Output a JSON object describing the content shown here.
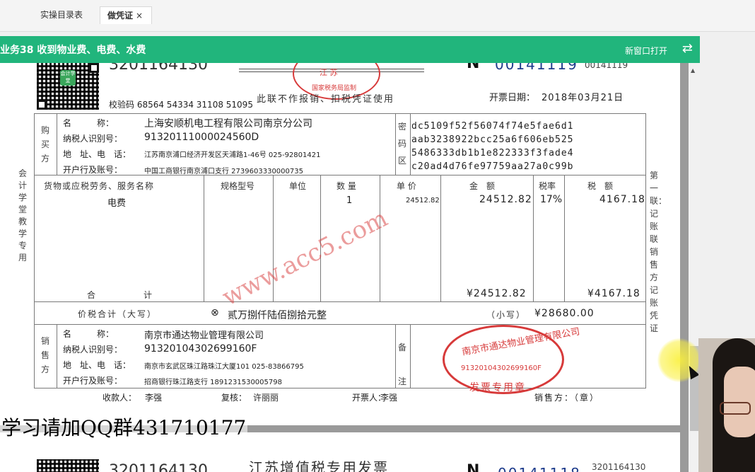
{
  "tabs": {
    "catalog": "实操目录表",
    "active": "做凭证",
    "close": "×"
  },
  "header": {
    "title": "业务38 收到物业费、电费、水费",
    "open_new_window": "新窗口打开",
    "swap_icon": "⇄"
  },
  "invoice": {
    "number_partial": "3201164130",
    "no_partial": "N",
    "serial_blue": "00141119",
    "serial_small": "00141119",
    "seal_top": "江 苏",
    "seal_arc": "国家税务局监制",
    "check_code": "校验码 68564 54334 31108 51095",
    "usage_note": "此联不作报销、扣税凭证使用",
    "issue_date_label": "开票日期：",
    "issue_date": "2018年03月21日",
    "qr_logo": "会计学堂",
    "side_left": "会计学堂教学专用",
    "side_right": "第一联：记账联 销售方记账凭证",
    "buyer": {
      "group": "购买方",
      "name_label": "名　　　称：",
      "name": "上海安顺机电工程有限公司南京分公司",
      "tax_label": "纳税人识别号：",
      "tax_id": "91320111000024560D",
      "addr_label": "地　址、电　话：",
      "addr": "江苏南京浦口经济开发区天浦路1-46号 025-92801421",
      "bank_label": "开户行及账号：",
      "bank": "中国工商银行南京浦口支行 2739603330000735"
    },
    "cipher": {
      "group": "密码区",
      "lines": [
        "dc5109f52f56074f74e5fae6d1",
        "aab3238922bcc25a6f606eb525",
        "5486333db1b1e822333f3fade4",
        "c20ad4d76fe97759aa27a0c99b"
      ]
    },
    "columns": {
      "item": "货物或应税劳务、服务名称",
      "spec": "规格型号",
      "unit": "单位",
      "qty": "数 量",
      "price": "单 价",
      "amount": "金　额",
      "rate": "税率",
      "tax": "税　额"
    },
    "row": {
      "item": "电费",
      "qty": "1",
      "price": "24512.82",
      "amount": "24512.82",
      "rate": "17%",
      "tax": "4167.18"
    },
    "total": {
      "label_a": "合",
      "label_b": "计",
      "amount": "¥24512.82",
      "tax": "¥4167.18"
    },
    "grand": {
      "label": "价税合计（大写）",
      "mark": "⊗",
      "words": "贰万捌仟陆佰捌拾元整",
      "small_label": "（小写）",
      "small_value": "¥28680.00"
    },
    "seller": {
      "group": "销售方",
      "name_label": "名　　　称：",
      "name": "南京市通达物业管理有限公司",
      "tax_label": "纳税人识别号：",
      "tax_id": "91320104302699160F",
      "addr_label": "地　址、电　话：",
      "addr": "南京市玄武区珠江路珠江大厦101 025-83866795",
      "bank_label": "开户行及账号：",
      "bank": "招商银行珠江路支行 1891231530005798"
    },
    "remark": "备注",
    "seal": {
      "name": "南京市通达物业管理有限公司",
      "tax_id": "91320104302699160F",
      "bottom": "发票专用章"
    },
    "payee_label": "收款人：",
    "payee": "李强",
    "reviewer_label": "复核：",
    "reviewer": "许丽丽",
    "drawer_label": "开票人：",
    "drawer": "李强",
    "seller_stamp": "销售方：（章）",
    "watermark": "www.acc5.com"
  },
  "invoice2": {
    "code": "3201164130",
    "title": "江苏增值税专用发票",
    "no": "N",
    "serial": "00141118",
    "code_small": "3201164130"
  },
  "overlay": {
    "qq_text": "学习请加QQ群431710177"
  }
}
